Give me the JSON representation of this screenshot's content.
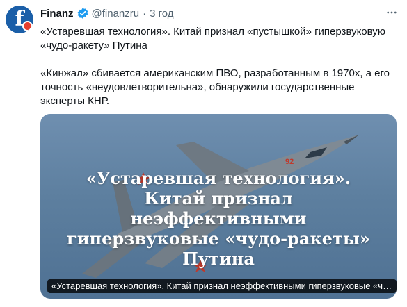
{
  "author": {
    "name": "Finanz",
    "handle": "@finanzru",
    "separator": "·",
    "time": "3 год",
    "avatar_letter": "f",
    "avatar_color": "#1b5fa8",
    "verified_color": "#1d9bf0"
  },
  "tweet": {
    "paragraph1": "«Устаревшая технология». Китай признал «пустышкой» гиперзвуковую «чудо-ракету» Путина",
    "paragraph2": "«Кинжал» сбивается американским ПВО, разработанным в 1970х, а его точность «неудовлетворительна», обнаружили государственные эксперты КНР."
  },
  "media": {
    "headline": "«Устаревшая технология». Китай признал неэффективными гиперзвуковые «чудо-ракеты» Путина",
    "caption": "«Устаревшая технология». Китай признал неэффективными гиперзвуковые «чудо-ракеты» Путина",
    "tail_number": "92"
  },
  "icons": {
    "verified": "verified-badge-icon",
    "more": "more-options-icon"
  }
}
